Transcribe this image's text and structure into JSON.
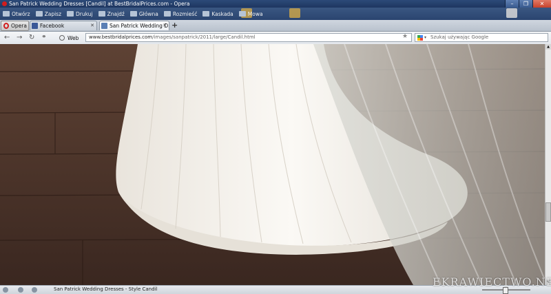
{
  "window": {
    "title": "San Patrick Wedding Dresses [Candil] at BestBridalPrices.com - Opera"
  },
  "menu": {
    "items": [
      {
        "label": "Otwórz",
        "icon": "folder-icon"
      },
      {
        "label": "Zapisz",
        "icon": "save-icon"
      },
      {
        "label": "Drukuj",
        "icon": "print-icon"
      },
      {
        "label": "Znajdź",
        "icon": "find-icon"
      },
      {
        "label": "Główna",
        "icon": "home-icon"
      },
      {
        "label": "Rozmieść",
        "icon": "tile-icon"
      },
      {
        "label": "Kaskada",
        "icon": "cascade-icon"
      },
      {
        "label": "Mowa",
        "icon": "speech-icon"
      }
    ]
  },
  "tabs": {
    "opera_button": "Opera",
    "items": [
      {
        "label": "Facebook",
        "favicon_color": "#3b5998"
      },
      {
        "label": "San Patrick Wedding D...",
        "favicon_color": "#5a7fb5"
      }
    ],
    "new_tab": "+"
  },
  "address": {
    "web_label": "Web",
    "url_domain": "www.bestbridalprices.com",
    "url_path": "/images/sanpatrick/2011/large/Candil.html",
    "search_placeholder": "Szukaj używając Google"
  },
  "status": {
    "text": "San Patrick Wedding Dresses - Style Candil"
  },
  "watermark": "EKRAWIECTWO.NET",
  "colors": {
    "titlebar": "#2c4a78",
    "opera_red": "#d21d1d",
    "floor": "#4a3127",
    "dress": "#f1ece4"
  }
}
